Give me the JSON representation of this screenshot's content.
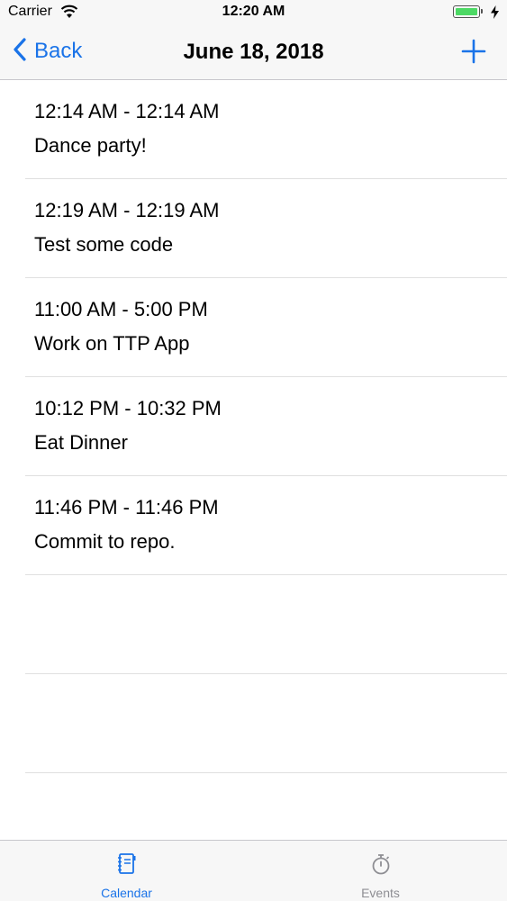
{
  "status_bar": {
    "carrier": "Carrier",
    "time": "12:20 AM"
  },
  "nav": {
    "back_label": "Back",
    "title": "June 18, 2018"
  },
  "events": [
    {
      "time_range": "12:14 AM - 12:14 AM",
      "title": "Dance party!"
    },
    {
      "time_range": "12:19 AM - 12:19 AM",
      "title": "Test some code"
    },
    {
      "time_range": "11:00 AM - 5:00 PM",
      "title": "Work on TTP App"
    },
    {
      "time_range": "10:12 PM - 10:32 PM",
      "title": "Eat Dinner"
    },
    {
      "time_range": "11:46 PM - 11:46 PM",
      "title": "Commit to repo."
    }
  ],
  "tabs": [
    {
      "label": "Calendar",
      "icon": "notebook-icon",
      "active": true
    },
    {
      "label": "Events",
      "icon": "stopwatch-icon",
      "active": false
    }
  ],
  "colors": {
    "accent": "#1a73e8",
    "inactive": "#8e8e93",
    "battery": "#4cd964"
  }
}
